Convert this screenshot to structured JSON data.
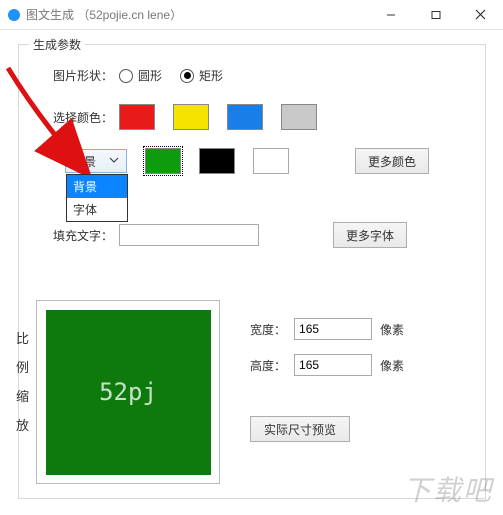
{
  "window": {
    "title": "图文生成 （52pojie.cn lene）"
  },
  "group": {
    "legend": "生成参数",
    "shape_label": "图片形状：",
    "shape_circle": "圆形",
    "shape_rect": "矩形",
    "color_label": "选择颜色：",
    "colors_row1": [
      "#e81b1b",
      "#f5e400",
      "#1a7ee8",
      "#c9c9c9"
    ],
    "colors_row2": [
      "#0e9b0e",
      "#000000",
      "#ffffff"
    ],
    "combo_value": "背景",
    "dropdown": [
      "背景",
      "字体"
    ],
    "more_colors_btn": "更多颜色",
    "fill_text_label": "填充文字：",
    "fill_text_value": "",
    "more_fonts_btn": "更多字体"
  },
  "preview": {
    "v_label": [
      "比",
      "例",
      "缩",
      "放"
    ],
    "sample_text": "52pj",
    "bg": "#0e7a0e"
  },
  "dims": {
    "width_label": "宽度：",
    "width_value": "165",
    "height_label": "高度：",
    "height_value": "165",
    "unit": "像素",
    "actual_btn": "实际尺寸预览"
  },
  "watermark": "下载吧"
}
